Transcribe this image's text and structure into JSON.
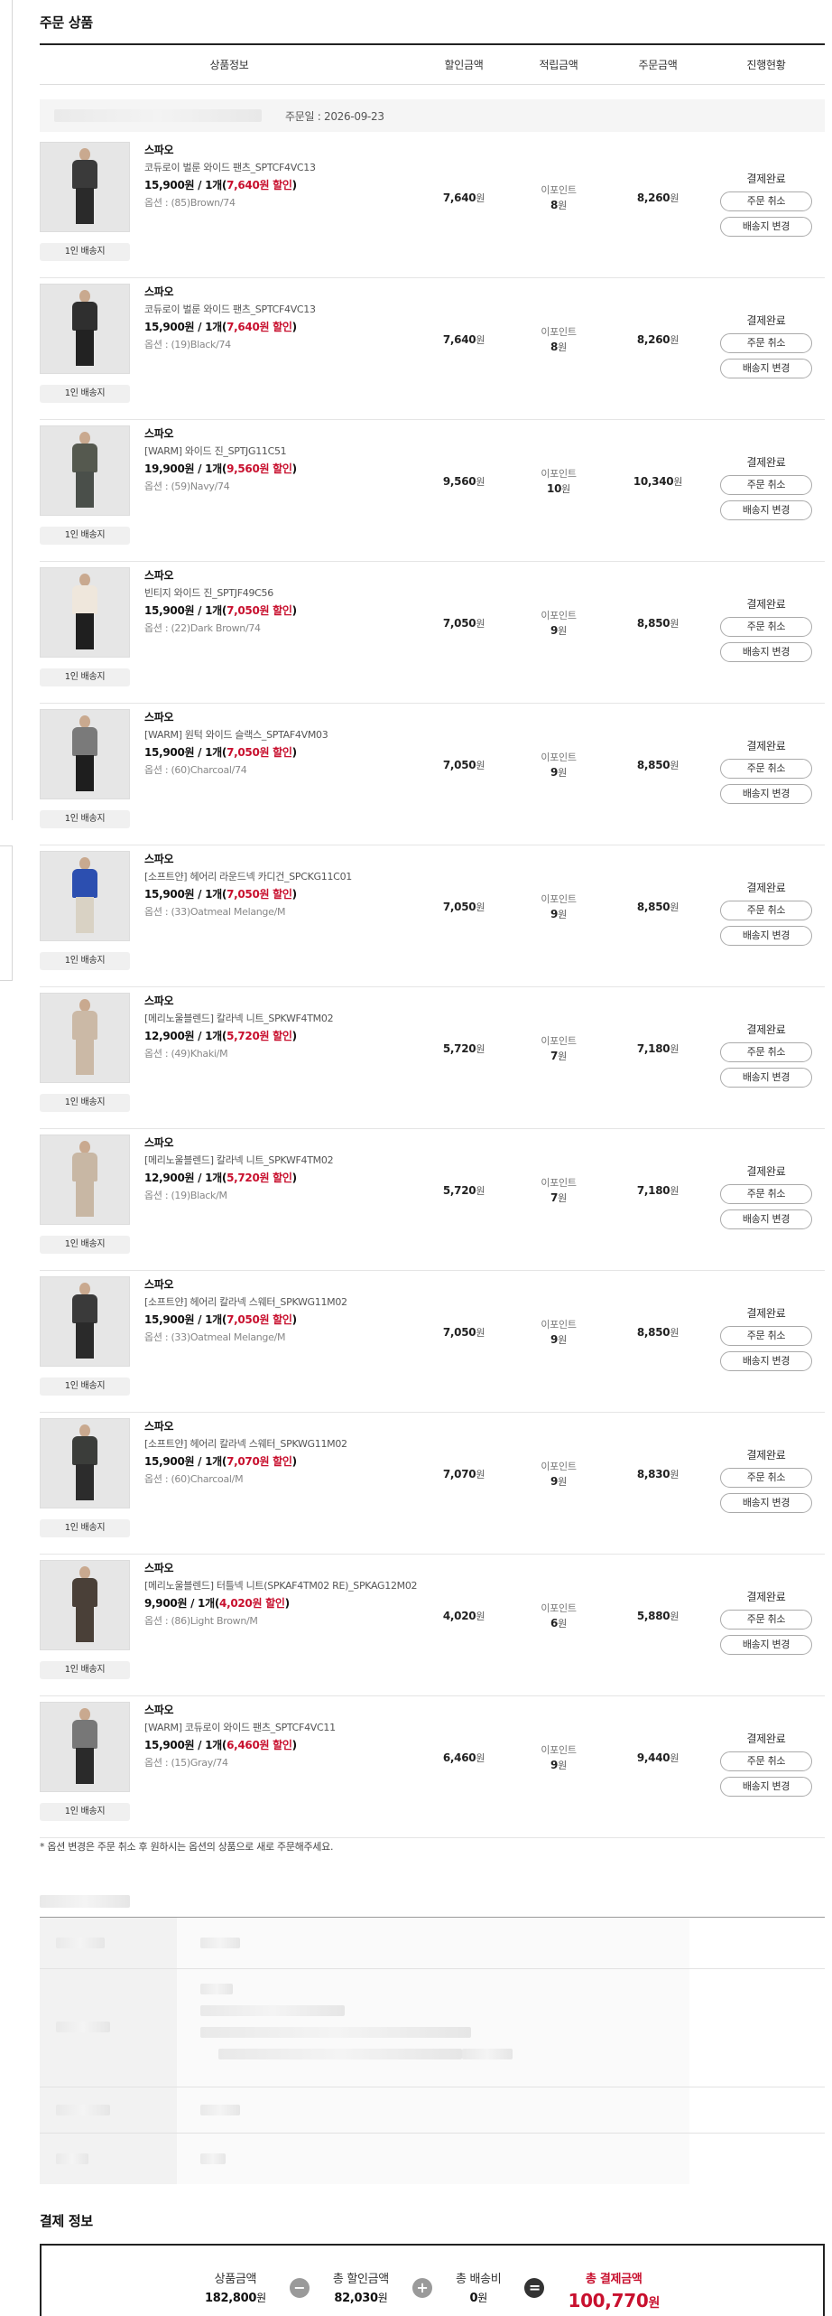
{
  "order_section": {
    "title": "주문 상품",
    "headers": [
      "상품정보",
      "할인금액",
      "적립금액",
      "주문금액",
      "진행현황"
    ],
    "order_date": "주문일 : 2026-09-23",
    "note": "* 옵션 변경은 주문 취소 후 원하시는 옵션의 상품으로 새로 주문해주세요."
  },
  "colors": {
    "accent": "#c8102e",
    "border": "#222222"
  },
  "items": [
    {
      "brand": "스파오",
      "name": "코듀로이 벌룬 와이드 팬츠_SPTCF4VC13",
      "price": "15,900원 / 1개",
      "discount_note": "7,640원 할인",
      "option": "옵션 : (85)Brown/74",
      "discount": "7,640",
      "point_label": "이포인트",
      "point": "8",
      "total": "8,260",
      "status": "결제완료",
      "cancel": "주문 취소",
      "change_addr": "배송지 변경",
      "ship": "1인 배송지"
    },
    {
      "brand": "스파오",
      "name": "코듀로이 벌룬 와이드 팬츠_SPTCF4VC13",
      "price": "15,900원 / 1개",
      "discount_note": "7,640원 할인",
      "option": "옵션 : (19)Black/74",
      "discount": "7,640",
      "point_label": "이포인트",
      "point": "8",
      "total": "8,260",
      "status": "결제완료",
      "cancel": "주문 취소",
      "change_addr": "배송지 변경",
      "ship": "1인 배송지"
    },
    {
      "brand": "스파오",
      "name": "[WARM] 와이드 진_SPTJG11C51",
      "price": "19,900원 / 1개",
      "discount_note": "9,560원 할인",
      "option": "옵션 : (59)Navy/74",
      "discount": "9,560",
      "point_label": "이포인트",
      "point": "10",
      "total": "10,340",
      "status": "결제완료",
      "cancel": "주문 취소",
      "change_addr": "배송지 변경",
      "ship": "1인 배송지"
    },
    {
      "brand": "스파오",
      "name": "빈티지 와이드 진_SPTJF49C56",
      "price": "15,900원 / 1개",
      "discount_note": "7,050원 할인",
      "option": "옵션 : (22)Dark Brown/74",
      "discount": "7,050",
      "point_label": "이포인트",
      "point": "9",
      "total": "8,850",
      "status": "결제완료",
      "cancel": "주문 취소",
      "change_addr": "배송지 변경",
      "ship": "1인 배송지"
    },
    {
      "brand": "스파오",
      "name": "[WARM] 원턱 와이드 슬랙스_SPTAF4VM03",
      "price": "15,900원 / 1개",
      "discount_note": "7,050원 할인",
      "option": "옵션 : (60)Charcoal/74",
      "discount": "7,050",
      "point_label": "이포인트",
      "point": "9",
      "total": "8,850",
      "status": "결제완료",
      "cancel": "주문 취소",
      "change_addr": "배송지 변경",
      "ship": "1인 배송지"
    },
    {
      "brand": "스파오",
      "name": "[소프트얀] 헤어리 라운드넥 카디건_SPCKG11C01",
      "price": "15,900원 / 1개",
      "discount_note": "7,050원 할인",
      "option": "옵션 : (33)Oatmeal Melange/M",
      "discount": "7,050",
      "point_label": "이포인트",
      "point": "9",
      "total": "8,850",
      "status": "결제완료",
      "cancel": "주문 취소",
      "change_addr": "배송지 변경",
      "ship": "1인 배송지"
    },
    {
      "brand": "스파오",
      "name": "[메리노울블렌드] 칼라넥 니트_SPKWF4TM02",
      "price": "12,900원 / 1개",
      "discount_note": "5,720원 할인",
      "option": "옵션 : (49)Khaki/M",
      "discount": "5,720",
      "point_label": "이포인트",
      "point": "7",
      "total": "7,180",
      "status": "결제완료",
      "cancel": "주문 취소",
      "change_addr": "배송지 변경",
      "ship": "1인 배송지"
    },
    {
      "brand": "스파오",
      "name": "[메리노울블렌드] 칼라넥 니트_SPKWF4TM02",
      "price": "12,900원 / 1개",
      "discount_note": "5,720원 할인",
      "option": "옵션 : (19)Black/M",
      "discount": "5,720",
      "point_label": "이포인트",
      "point": "7",
      "total": "7,180",
      "status": "결제완료",
      "cancel": "주문 취소",
      "change_addr": "배송지 변경",
      "ship": "1인 배송지"
    },
    {
      "brand": "스파오",
      "name": "[소프트얀] 헤어리 칼라넥 스웨터_SPKWG11M02",
      "price": "15,900원 / 1개",
      "discount_note": "7,050원 할인",
      "option": "옵션 : (33)Oatmeal Melange/M",
      "discount": "7,050",
      "point_label": "이포인트",
      "point": "9",
      "total": "8,850",
      "status": "결제완료",
      "cancel": "주문 취소",
      "change_addr": "배송지 변경",
      "ship": "1인 배송지"
    },
    {
      "brand": "스파오",
      "name": "[소프트얀] 헤어리 칼라넥 스웨터_SPKWG11M02",
      "price": "15,900원 / 1개",
      "discount_note": "7,070원 할인",
      "option": "옵션 : (60)Charcoal/M",
      "discount": "7,070",
      "point_label": "이포인트",
      "point": "9",
      "total": "8,830",
      "status": "결제완료",
      "cancel": "주문 취소",
      "change_addr": "배송지 변경",
      "ship": "1인 배송지"
    },
    {
      "brand": "스파오",
      "name": "[메리노울블렌드] 터틀넥 니트(SPKAF4TM02 RE)_SPKAG12M02",
      "price": "9,900원 / 1개",
      "discount_note": "4,020원 할인",
      "option": "옵션 : (86)Light Brown/M",
      "discount": "4,020",
      "point_label": "이포인트",
      "point": "6",
      "total": "5,880",
      "status": "결제완료",
      "cancel": "주문 취소",
      "change_addr": "배송지 변경",
      "ship": "1인 배송지"
    },
    {
      "brand": "스파오",
      "name": "[WARM] 코듀로이 와이드 팬츠_SPTCF4VC11",
      "price": "15,900원 / 1개",
      "discount_note": "6,460원 할인",
      "option": "옵션 : (15)Gray/74",
      "discount": "6,460",
      "point_label": "이포인트",
      "point": "9",
      "total": "9,440",
      "status": "결제완료",
      "cancel": "주문 취소",
      "change_addr": "배송지 변경",
      "ship": "1인 배송지"
    }
  ],
  "units": {
    "won": "원"
  },
  "payment": {
    "title": "결제 정보",
    "product_label": "상품금액",
    "product_value": "182,800",
    "discount_label": "총 할인금액",
    "discount_value": "82,030",
    "shipping_label": "총 배송비",
    "shipping_value": "0",
    "total_label": "총 결제금액",
    "total_value": "100,770"
  }
}
